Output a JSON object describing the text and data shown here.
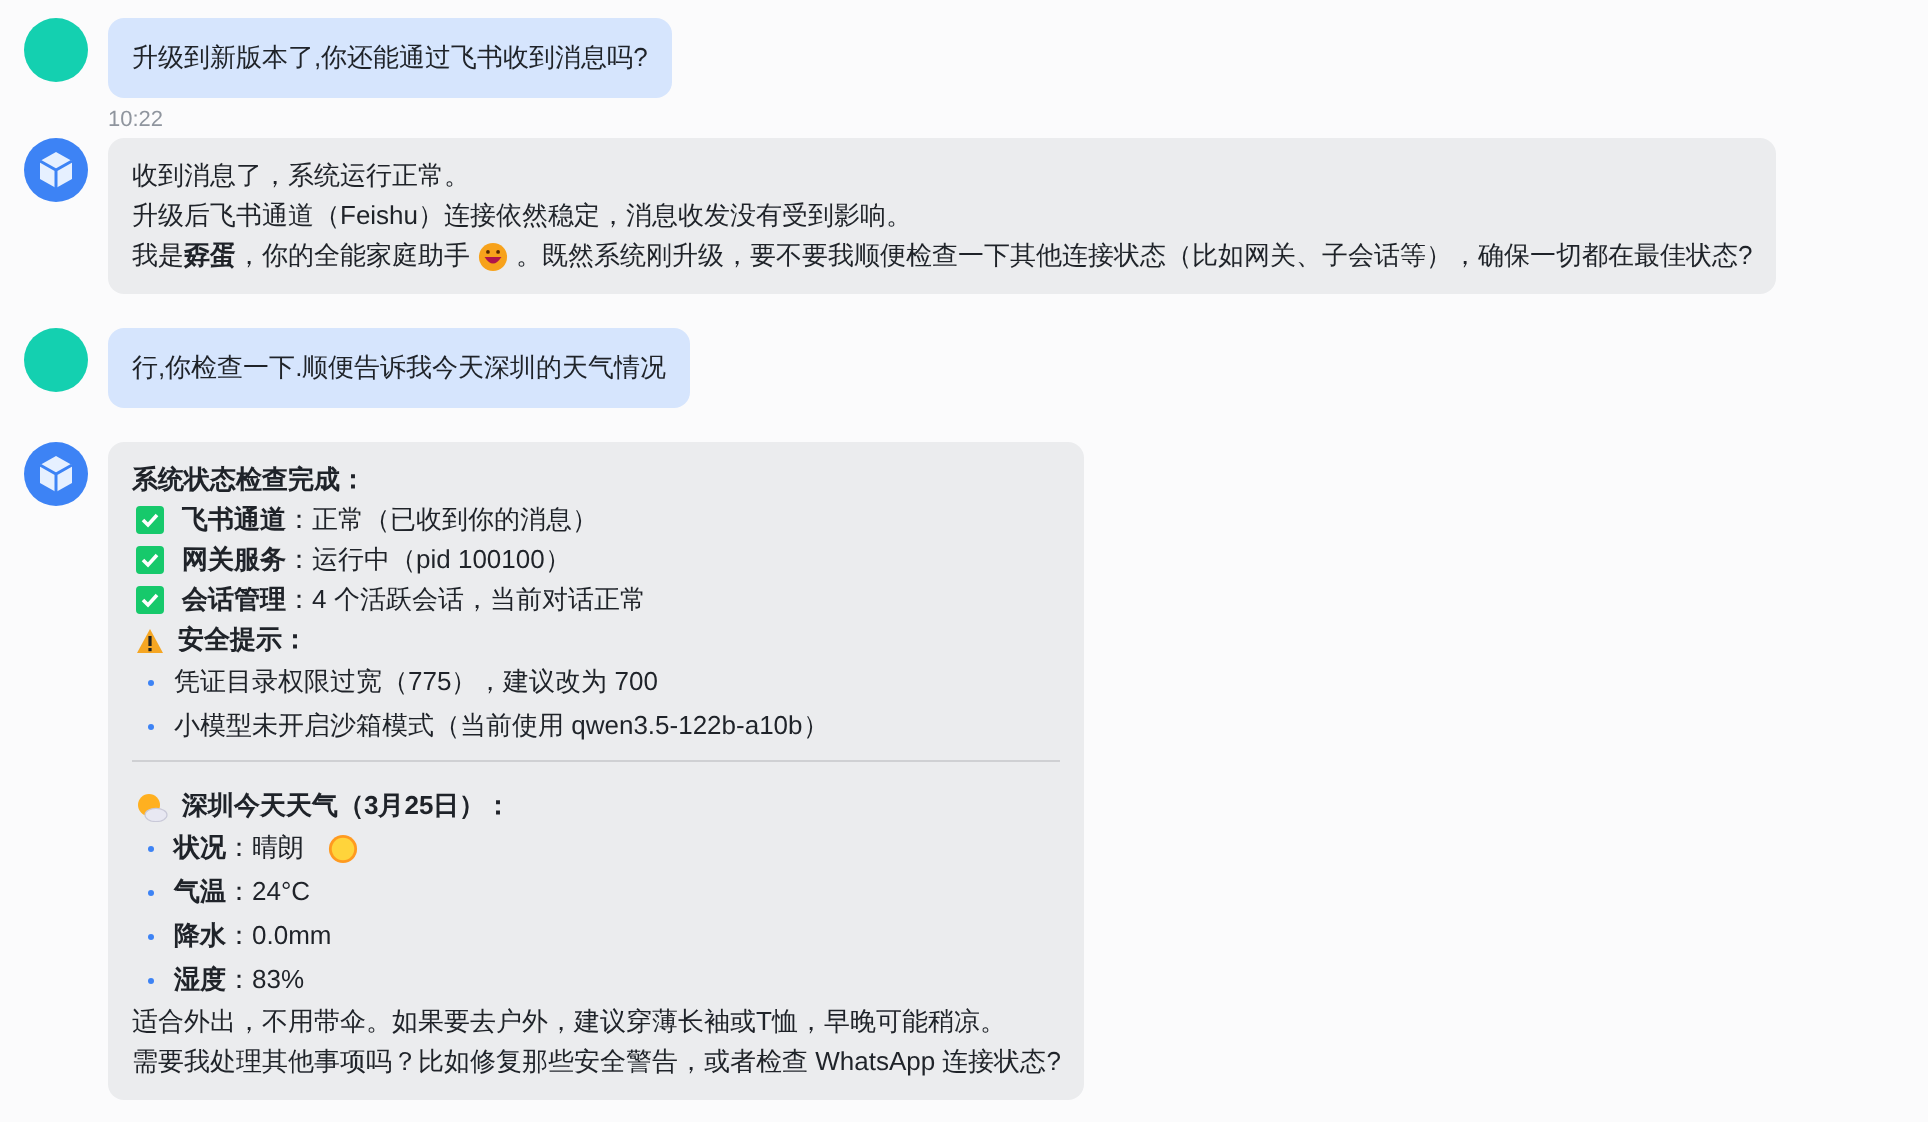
{
  "messages": [
    {
      "kind": "user",
      "text": "升级到新版本了,你还能通过飞书收到消息吗?"
    },
    {
      "kind": "bot",
      "time": "10:22",
      "lines": [
        {
          "kind": "text",
          "text": "收到消息了，系统运行正常。"
        },
        {
          "kind": "text",
          "text": "升级后飞书通道（Feishu）连接依然稳定，消息收发没有受到影响。"
        },
        {
          "kind": "emoji",
          "text": "我是**孬蛋**，你的全能家庭助手",
          "after": "。既然系统刚升级，要不要我顺便检查一下其他连接状态（比如网关、子会话等），确保一切都在最佳状态?"
        }
      ]
    },
    {
      "kind": "user",
      "text": "行,你检查一下.顺便告诉我今天深圳的天气情况"
    },
    {
      "kind": "bot",
      "lines": [
        {
          "kind": "heading",
          "text": "系统状态检查完成："
        },
        {
          "kind": "check",
          "text": "**飞书通道**：正常（已收到你的消息）"
        },
        {
          "kind": "check",
          "text": "**网关服务**：运行中（pid 100100）"
        },
        {
          "kind": "check",
          "text": "**会话管理**：4 个活跃会话，当前对话正常"
        },
        {
          "kind": "warning",
          "text": "安全提示："
        },
        {
          "kind": "bullet",
          "text": "凭证目录权限过宽（775），建议改为 700"
        },
        {
          "kind": "bullet",
          "text": "小模型未开启沙箱模式（当前使用 qwen3.5-122b-a10b）"
        },
        {
          "kind": "divider"
        },
        {
          "kind": "weather",
          "text": "深圳今天天气（3月25日）："
        },
        {
          "kind": "sunny",
          "text": "**状况**：晴朗"
        },
        {
          "kind": "bullet",
          "text": "**气温**：24°C"
        },
        {
          "kind": "bullet",
          "text": "**降水**：0.0mm"
        },
        {
          "kind": "bullet",
          "text": "**湿度**：83%"
        },
        {
          "kind": "text",
          "text": "适合外出，不用带伞。如果要去户外，建议穿薄长袖或T恤，早晚可能稍凉。"
        },
        {
          "kind": "text",
          "text": "需要我处理其他事项吗？比如修复那些安全警告，或者检查 WhatsApp 连接状态?"
        }
      ]
    }
  ]
}
